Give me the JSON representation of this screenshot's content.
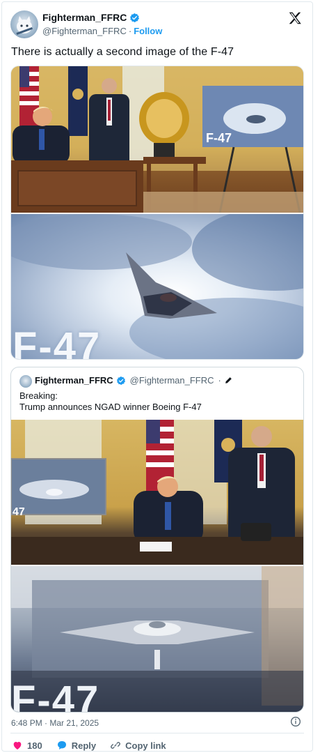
{
  "post": {
    "display_name": "Fighterman_FFRC",
    "handle": "@Fighterman_FFRC",
    "separator": "·",
    "follow_label": "Follow",
    "text": "There is actually a second image of the F-47",
    "media_caption": "F-47"
  },
  "quote": {
    "display_name": "Fighterman_FFRC",
    "handle": "@Fighterman_FFRC",
    "separator": "·",
    "text_line1": "Breaking:",
    "text_line2": "Trump announces NGAD winner Boeing F-47",
    "media_caption_left": "47",
    "media_caption": "F-47"
  },
  "footer": {
    "timestamp": "6:48 PM · Mar 21, 2025",
    "like_count": "180",
    "reply_label": "Reply",
    "copy_label": "Copy link"
  },
  "colors": {
    "accent": "#1d9bf0",
    "like": "#f91880",
    "muted": "#536471"
  }
}
